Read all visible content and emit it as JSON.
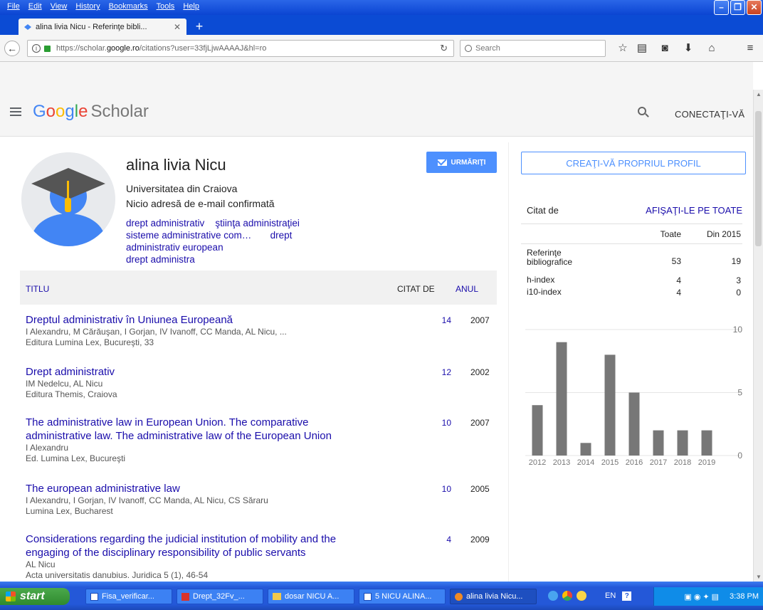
{
  "browser": {
    "menu": [
      "File",
      "Edit",
      "View",
      "History",
      "Bookmarks",
      "Tools",
      "Help"
    ],
    "tab_title": "alina livia Nicu - Referinţe bibli...",
    "url_prefix": "https://scholar.",
    "url_domain": "google.ro",
    "url_path": "/citations?user=33fjLjwAAAAJ&hl=ro",
    "search_placeholder": "Search"
  },
  "header": {
    "logo_google": [
      "G",
      "o",
      "o",
      "g",
      "l",
      "e"
    ],
    "logo_scholar": "Scholar",
    "signin": "CONECTAŢI-VĂ"
  },
  "profile": {
    "name": "alina livia Nicu",
    "affiliation": "Universitatea din Craiova",
    "email": "Nicio adresă de e-mail confirmată",
    "interests": [
      "drept administrativ",
      "ştiinţa administraţiei",
      "sisteme administrative com…",
      "drept administrativ european",
      "drept administra"
    ],
    "follow_label": "URMĂRIŢI"
  },
  "table": {
    "col_title": "TITLU",
    "col_cited": "CITAT DE",
    "col_year": "ANUL",
    "articles": [
      {
        "title": "Dreptul administrativ în Uniunea Europeană",
        "authors": "I Alexandru, M Cărăuşan, I Gorjan, IV Ivanoff, CC Manda, AL Nicu, ...",
        "venue": "Editura Lumina Lex, Bucureşti, 33",
        "cited": "14",
        "year": "2007"
      },
      {
        "title": "Drept administrativ",
        "authors": "IM Nedelcu, AL Nicu",
        "venue": "Editura Themis, Craiova",
        "cited": "12",
        "year": "2002"
      },
      {
        "title": "The administrative law in European Union. The comparative administrative law. The administrative law of the European Union",
        "authors": "I Alexandru",
        "venue": "Ed. Lumina Lex, Bucureşti",
        "cited": "10",
        "year": "2007"
      },
      {
        "title": "The european administrative law",
        "authors": "I Alexandru, I Gorjan, IV Ivanoff, CC Manda, AL Nicu, CS Săraru",
        "venue": "Lumina Lex, Bucharest",
        "cited": "10",
        "year": "2005"
      },
      {
        "title": "Considerations regarding the judicial institution of mobility and the engaging of the disciplinary responsibility of public servants",
        "authors": "AL Nicu",
        "venue": "Acta universitatis danubius. Juridica 5 (1), 46-54",
        "cited": "4",
        "year": "2009"
      }
    ]
  },
  "sidebar": {
    "create_profile": "CREAŢI-VĂ PROPRIUL PROFIL",
    "cited_by": "Citat de",
    "show_all": "AFIŞAŢI-LE PE TOATE",
    "col_all": "Toate",
    "col_since": "Din 2015",
    "metrics": [
      {
        "label": "Referinţe bibliografice",
        "all": "53",
        "since": "19"
      },
      {
        "label": "h-index",
        "all": "4",
        "since": "3"
      },
      {
        "label": "i10-index",
        "all": "4",
        "since": "0"
      }
    ]
  },
  "chart_data": {
    "type": "bar",
    "categories": [
      "2012",
      "2013",
      "2014",
      "2015",
      "2016",
      "2017",
      "2018",
      "2019"
    ],
    "values": [
      4,
      9,
      1,
      8,
      5,
      2,
      2,
      2
    ],
    "y_ticks": [
      "10",
      "5",
      "0"
    ],
    "ylim": [
      0,
      10
    ],
    "bar_color": "#777777",
    "grid": true
  },
  "taskbar": {
    "start": "start",
    "items": [
      "Fisa_verificar...",
      "Drept_32Fv_...",
      "dosar NICU A...",
      "5 NICU ALINA...",
      "alina livia Nicu..."
    ],
    "lang": "EN",
    "clock": "3:38 PM"
  },
  "colors": {
    "link": "#1a0dab",
    "accent": "#4d90fe",
    "xp_blue": "#0b45d2",
    "taskbar": "#245edb"
  }
}
